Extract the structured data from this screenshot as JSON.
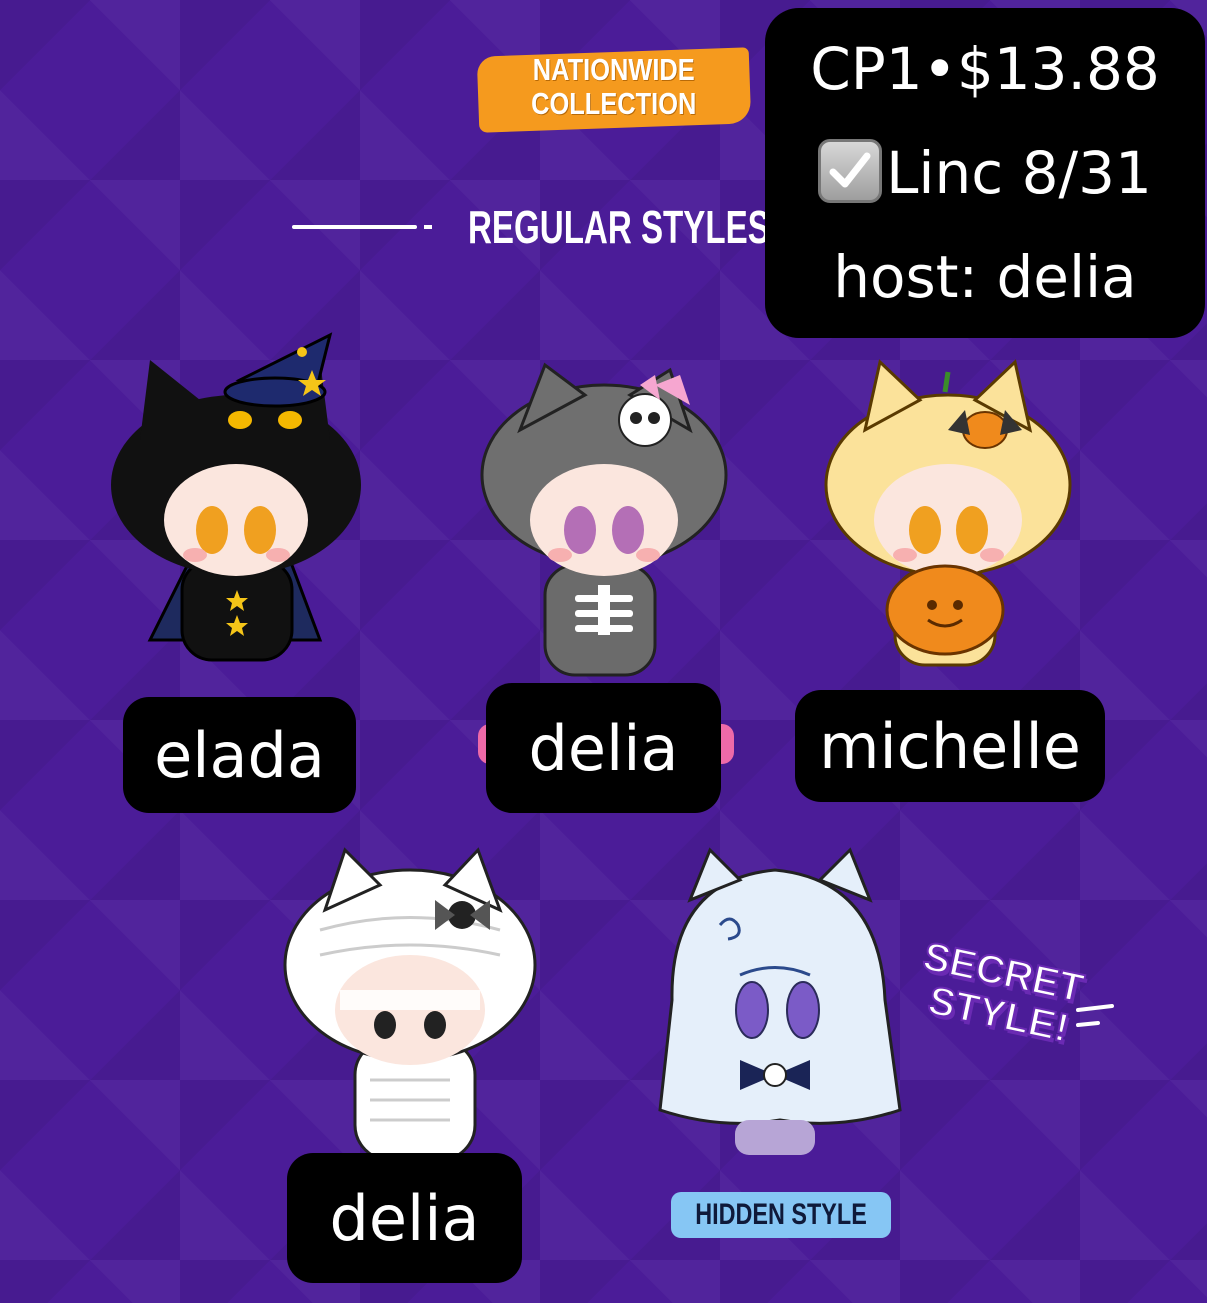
{
  "banner": {
    "line1": "NATIONWIDE",
    "line2": "COLLECTION"
  },
  "section_title": "REGULAR STYLES",
  "info": {
    "line1": "CP1•$13.88",
    "line2": "Linc 8/31",
    "line3": "host: delia",
    "check_icon": "check-box-icon"
  },
  "tags": [
    "elada",
    "delia",
    "michelle",
    "delia"
  ],
  "hidden_label": "HIDDEN STYLE",
  "secret_label": {
    "line1": "SECRET",
    "line2": "STYLE!"
  },
  "colors": {
    "background": "#4b1c98",
    "accent_orange": "#f59a1e",
    "tag_bg": "#000000",
    "hidden_bg": "#86c6f4",
    "pink": "#ee6aa8"
  }
}
